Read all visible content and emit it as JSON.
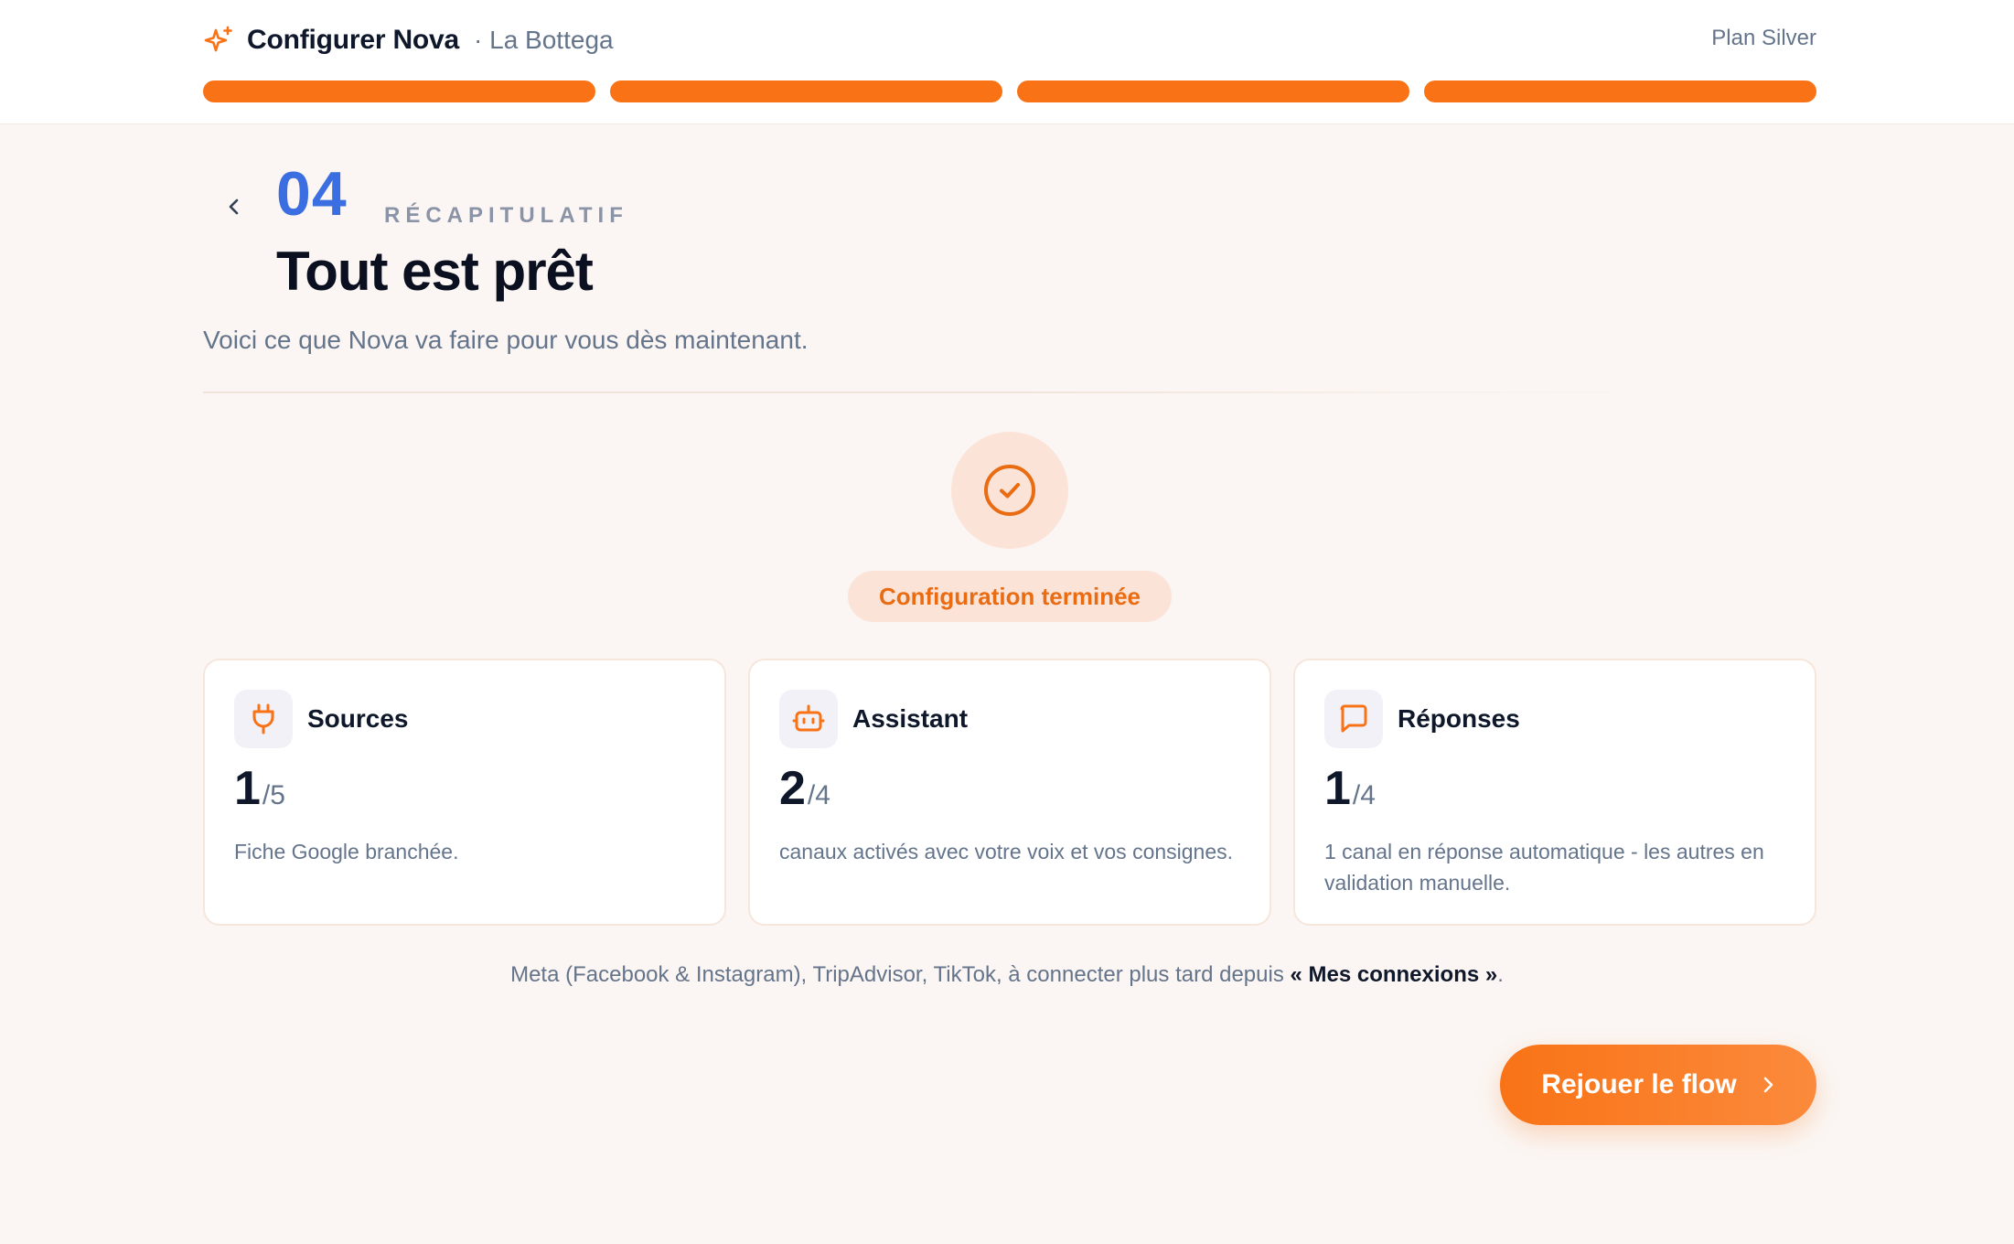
{
  "header": {
    "brand_title": "Configurer Nova",
    "brand_subtitle": "· La Bottega",
    "plan": "Plan Silver",
    "progress_steps_total": 4,
    "progress_steps_completed": 4
  },
  "step": {
    "number": "04",
    "label": "RÉCAPITULATIF",
    "title": "Tout est prêt",
    "subtitle": "Voici ce que Nova va faire pour vous dès maintenant."
  },
  "status": {
    "badge": "Configuration terminée"
  },
  "cards": [
    {
      "title": "Sources",
      "stat_main": "1",
      "stat_total": "/5",
      "description": "Fiche Google branchée.",
      "icon": "plug-icon"
    },
    {
      "title": "Assistant",
      "stat_main": "2",
      "stat_total": "/4",
      "description": "canaux activés avec votre voix et vos consignes.",
      "icon": "robot-icon"
    },
    {
      "title": "Réponses",
      "stat_main": "1",
      "stat_total": "/4",
      "description": "1 canal en réponse automatique - les autres en validation manuelle.",
      "icon": "chat-bubble-icon"
    }
  ],
  "note": {
    "text": "Meta (Facebook & Instagram), TripAdvisor, TikTok, à connecter plus tard depuis ",
    "link": "« Mes connexions »",
    "suffix": "."
  },
  "actions": {
    "replay_label": "Rejouer le flow"
  },
  "colors": {
    "accent": "#f97316",
    "step_number": "#3b6ee0",
    "badge_bg": "#fbe3d8"
  }
}
